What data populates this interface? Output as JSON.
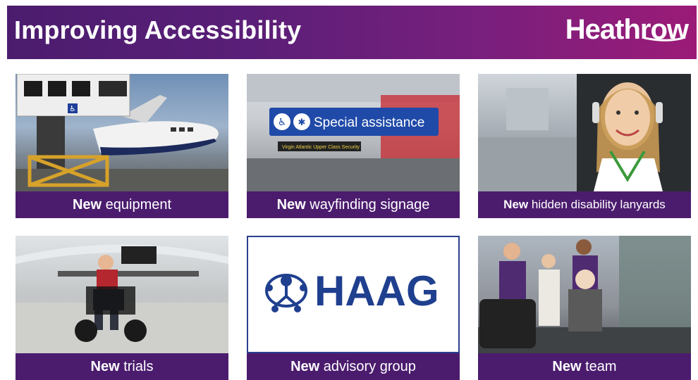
{
  "header": {
    "title": "Improving Accessibility",
    "logo_text": "Heathrow"
  },
  "tiles": [
    {
      "bold": "New",
      "rest": " equipment"
    },
    {
      "bold": "New",
      "rest": " wayfinding signage",
      "sign_text": "Special assistance",
      "sign_sub": "Virgin Atlantic Upper Class Security"
    },
    {
      "bold": "New",
      "rest": " hidden disability lanyards"
    },
    {
      "bold": "New",
      "rest": " trials"
    },
    {
      "bold": "New",
      "rest": " advisory group",
      "logo_text": "HAAG"
    },
    {
      "bold": "New",
      "rest": " team"
    }
  ],
  "colors": {
    "banner_start": "#4b1c6e",
    "banner_end": "#9b1b77",
    "caption_bg": "#4b1c6e",
    "haag_blue": "#1f3f8f"
  },
  "icons": [
    "wheelchair-icon",
    "assistance-icon",
    "haag-logo-icon"
  ]
}
